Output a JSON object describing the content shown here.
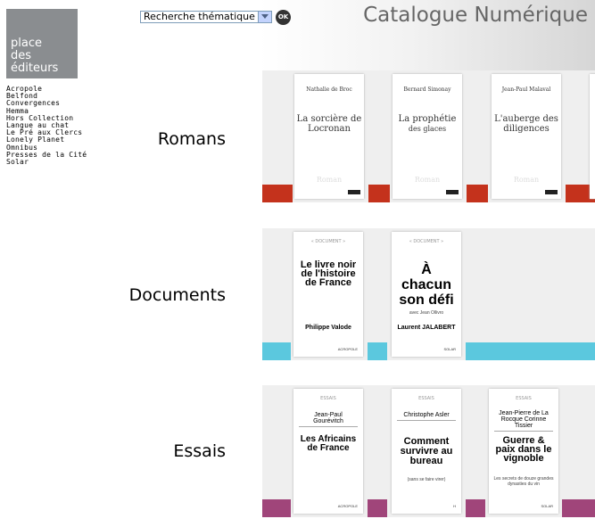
{
  "logo": {
    "line1": "place",
    "line2": "des",
    "line3": "éditeurs"
  },
  "nav": [
    "Acropole",
    "Belfond",
    "Convergences",
    "Hemma",
    "Hors Collection",
    "Langue au chat",
    "Le Pré aux Clercs",
    "Lonely Planet",
    "Omnibus",
    "Presses de la Cité",
    "Solar"
  ],
  "search": {
    "selected": "Recherche thématique",
    "ok_label": "OK"
  },
  "header": {
    "title": "Catalogue Numérique"
  },
  "categories": [
    {
      "label": "Romans",
      "color": "#c4321c",
      "books": [
        {
          "author": "Nathalie de Broc",
          "title": "La sorcière de Locronan",
          "collection": "Roman"
        },
        {
          "author": "Bernard Simonay",
          "title_line1": "La prophétie",
          "title_line2": "des glaces",
          "collection": "Roman"
        },
        {
          "author": "Jean-Paul Malaval",
          "title": "L'auberge des diligences",
          "collection": "Roman"
        }
      ]
    },
    {
      "label": "Documents",
      "color": "#5bc8de",
      "books": [
        {
          "header": "« DOCUMENT »",
          "title": "Le livre noir de l'histoire de France",
          "author": "Philippe Valode",
          "publisher": "ACROPOLE"
        },
        {
          "header": "« DOCUMENT »",
          "title": "À chacun son défi",
          "subtitle": "avec Jean Ollivro",
          "author": "Laurent JALABERT",
          "publisher": "SOLAR"
        }
      ]
    },
    {
      "label": "Essais",
      "color": "#a0457a",
      "books": [
        {
          "header": "ESSAIS",
          "author": "Jean-Paul Gourévitch",
          "title": "Les Africains de France",
          "publisher": "ACROPOLE"
        },
        {
          "header": "ESSAIS",
          "author": "Christophe Asler",
          "title": "Comment survivre au bureau",
          "subtitle": "(sans se faire virer)",
          "publisher": "H"
        },
        {
          "header": "ESSAIS",
          "author": "Jean-Pierre de La Rocque Corinne Tissier",
          "title": "Guerre & paix dans le vignoble",
          "subtitle": "Les secrets de douze grandes dynasties du vin",
          "publisher": "SOLAR"
        }
      ]
    }
  ]
}
